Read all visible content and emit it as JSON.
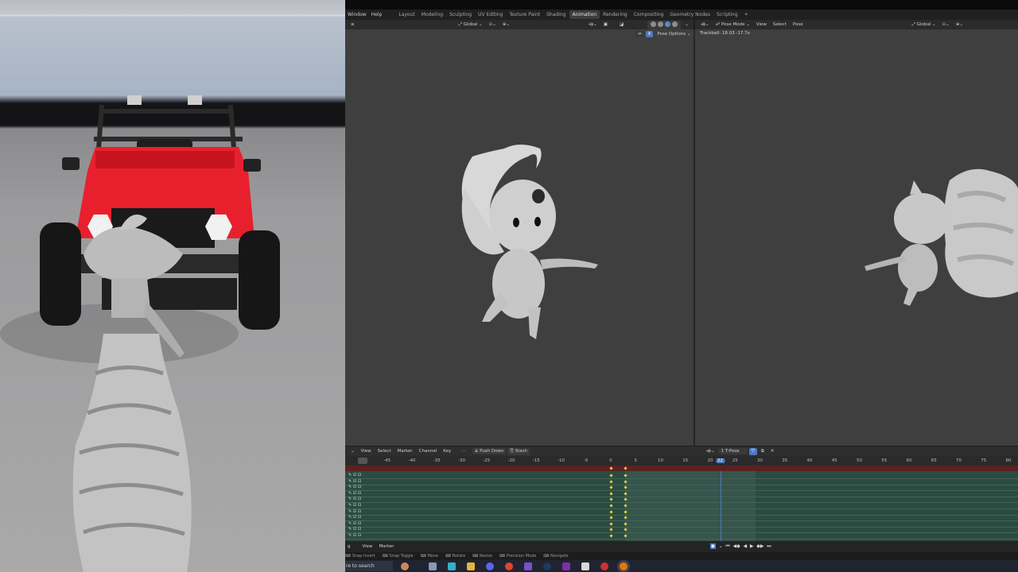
{
  "blender": {
    "menu": [
      "Window",
      "Help"
    ],
    "workspaces": [
      {
        "label": "Layout",
        "active": false
      },
      {
        "label": "Modeling",
        "active": false
      },
      {
        "label": "Sculpting",
        "active": false
      },
      {
        "label": "UV Editing",
        "active": false
      },
      {
        "label": "Texture Paint",
        "active": false
      },
      {
        "label": "Shading",
        "active": false
      },
      {
        "label": "Animation",
        "active": true
      },
      {
        "label": "Rendering",
        "active": false
      },
      {
        "label": "Compositing",
        "active": false
      },
      {
        "label": "Geometry Nodes",
        "active": false
      },
      {
        "label": "Scripting",
        "active": false
      }
    ],
    "add_workspace": "+",
    "left_header": {
      "orientation": "Global"
    },
    "pose_options": "Pose Options",
    "right_header": {
      "mode": "Pose Mode",
      "menus": [
        "View",
        "Select",
        "Pose"
      ],
      "orientation": "Global"
    },
    "trackball_readout": "Trackball: 18.03 -17.7o"
  },
  "dopesheet": {
    "menus": [
      "View",
      "Select",
      "Marker",
      "Channel",
      "Key"
    ],
    "push_down": "Push Down",
    "stash": "Stash",
    "action_name": "1 T-Pose",
    "ruler_ticks": [
      "-45",
      "-40",
      "-35",
      "-30",
      "-25",
      "-20",
      "-15",
      "-10",
      "-5",
      "0",
      "5",
      "10",
      "15",
      "20",
      "22",
      "25",
      "30",
      "35",
      "40",
      "45",
      "50",
      "55",
      "60",
      "65",
      "70",
      "75",
      "80"
    ],
    "current_frame": "22",
    "track_count": 11,
    "keyframe_frames": [
      0,
      3
    ]
  },
  "timeline": {
    "left_label": "g",
    "menus": [
      "View",
      "Marker"
    ]
  },
  "statusbar": [
    "Snap Invert",
    "Snap Toggle",
    "Move",
    "Rotate",
    "Resize",
    "Precision Mode",
    "Navigate"
  ],
  "taskbar": {
    "search_placeholder": "re to search"
  },
  "colors": {
    "accent": "#4b79c3",
    "keyframe": "#e8c93c",
    "track_bg": "#2b4b41",
    "jeep_body": "#e8202d"
  }
}
